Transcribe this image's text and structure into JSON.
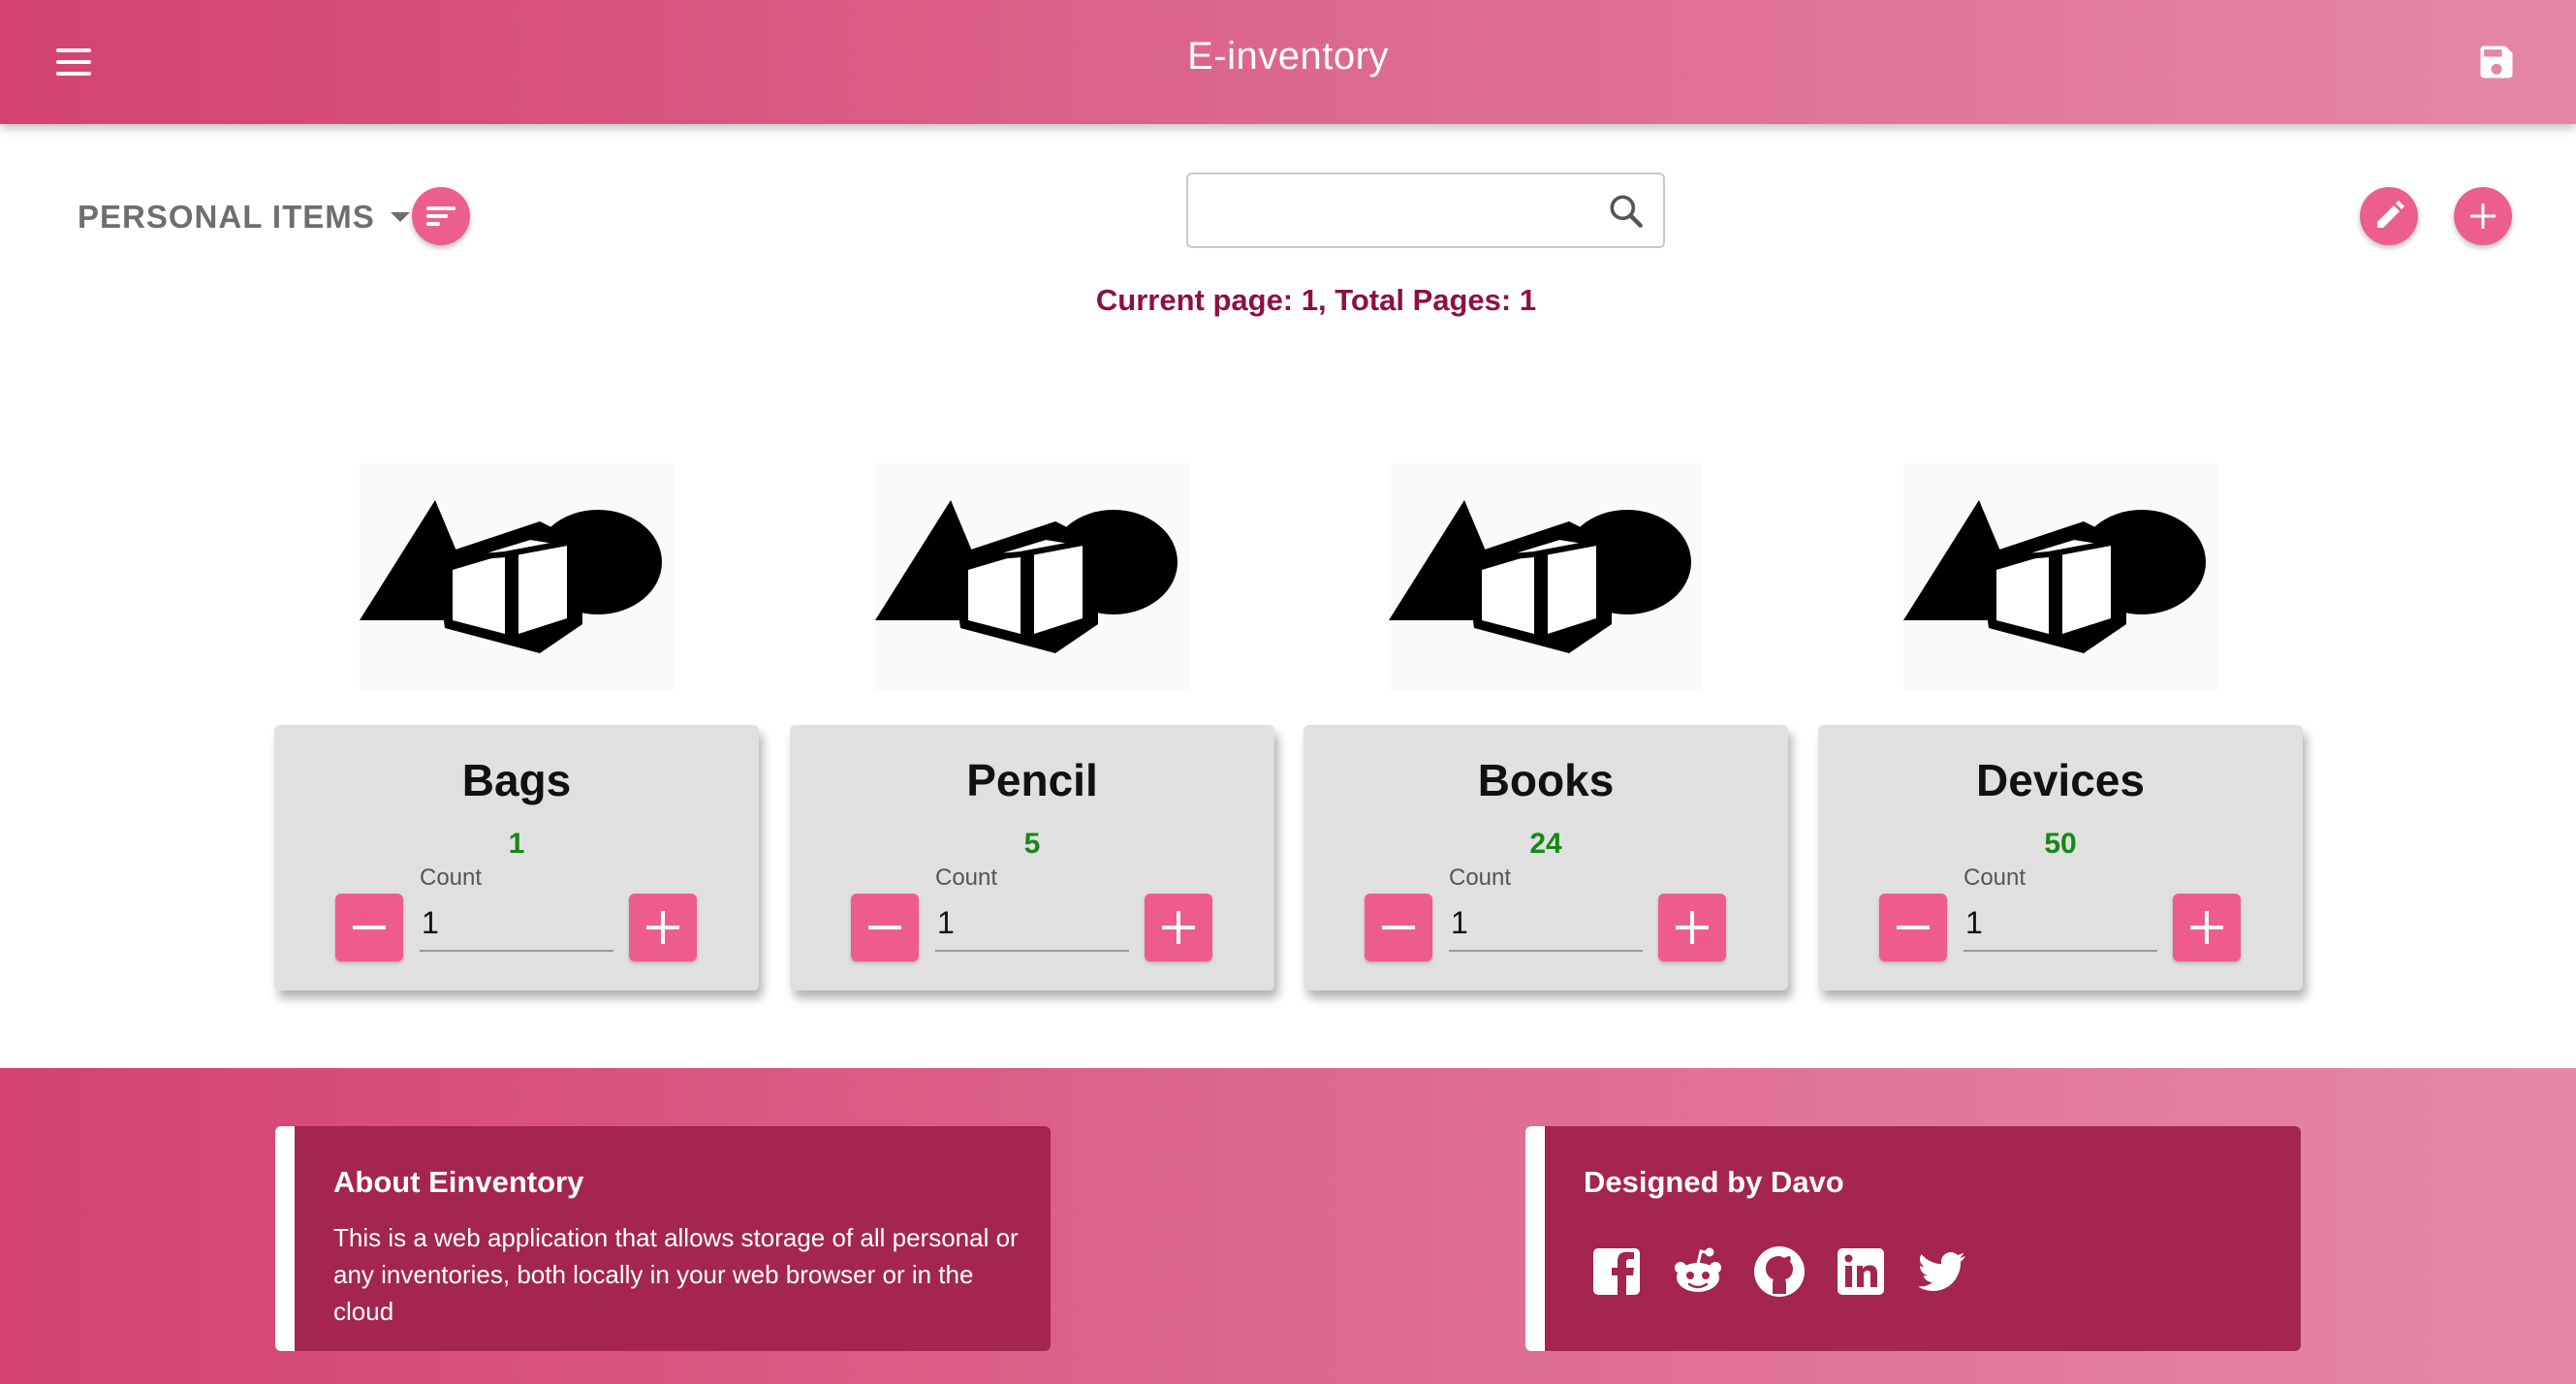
{
  "app": {
    "title": "E-inventory"
  },
  "toolbar": {
    "category": "PERSONAL ITEMS",
    "search_value": "",
    "page_info": "Current page: 1, Total Pages: 1"
  },
  "items": [
    {
      "name": "Bags",
      "total": "1",
      "count_label": "Count",
      "count_value": "1"
    },
    {
      "name": "Pencil",
      "total": "5",
      "count_label": "Count",
      "count_value": "1"
    },
    {
      "name": "Books",
      "total": "24",
      "count_label": "Count",
      "count_value": "1"
    },
    {
      "name": "Devices",
      "total": "50",
      "count_label": "Count",
      "count_value": "1"
    }
  ],
  "footer": {
    "about_title": "About Einventory",
    "about_text": "This is a web application that allows storage of all personal or any inventories, both locally in your web browser or in the cloud",
    "designer": "Designed by Davo",
    "socials": [
      "facebook-icon",
      "reddit-icon",
      "github-icon",
      "linkedin-icon",
      "twitter-icon"
    ]
  },
  "colors": {
    "header_gradient_start": "#d4436f",
    "header_gradient_end": "#e687a8",
    "accent": "#ec5f8c",
    "page_info": "#8e1043",
    "total": "#138a13",
    "footer_card": "#a32550",
    "card_bg": "#e0e0e0"
  }
}
